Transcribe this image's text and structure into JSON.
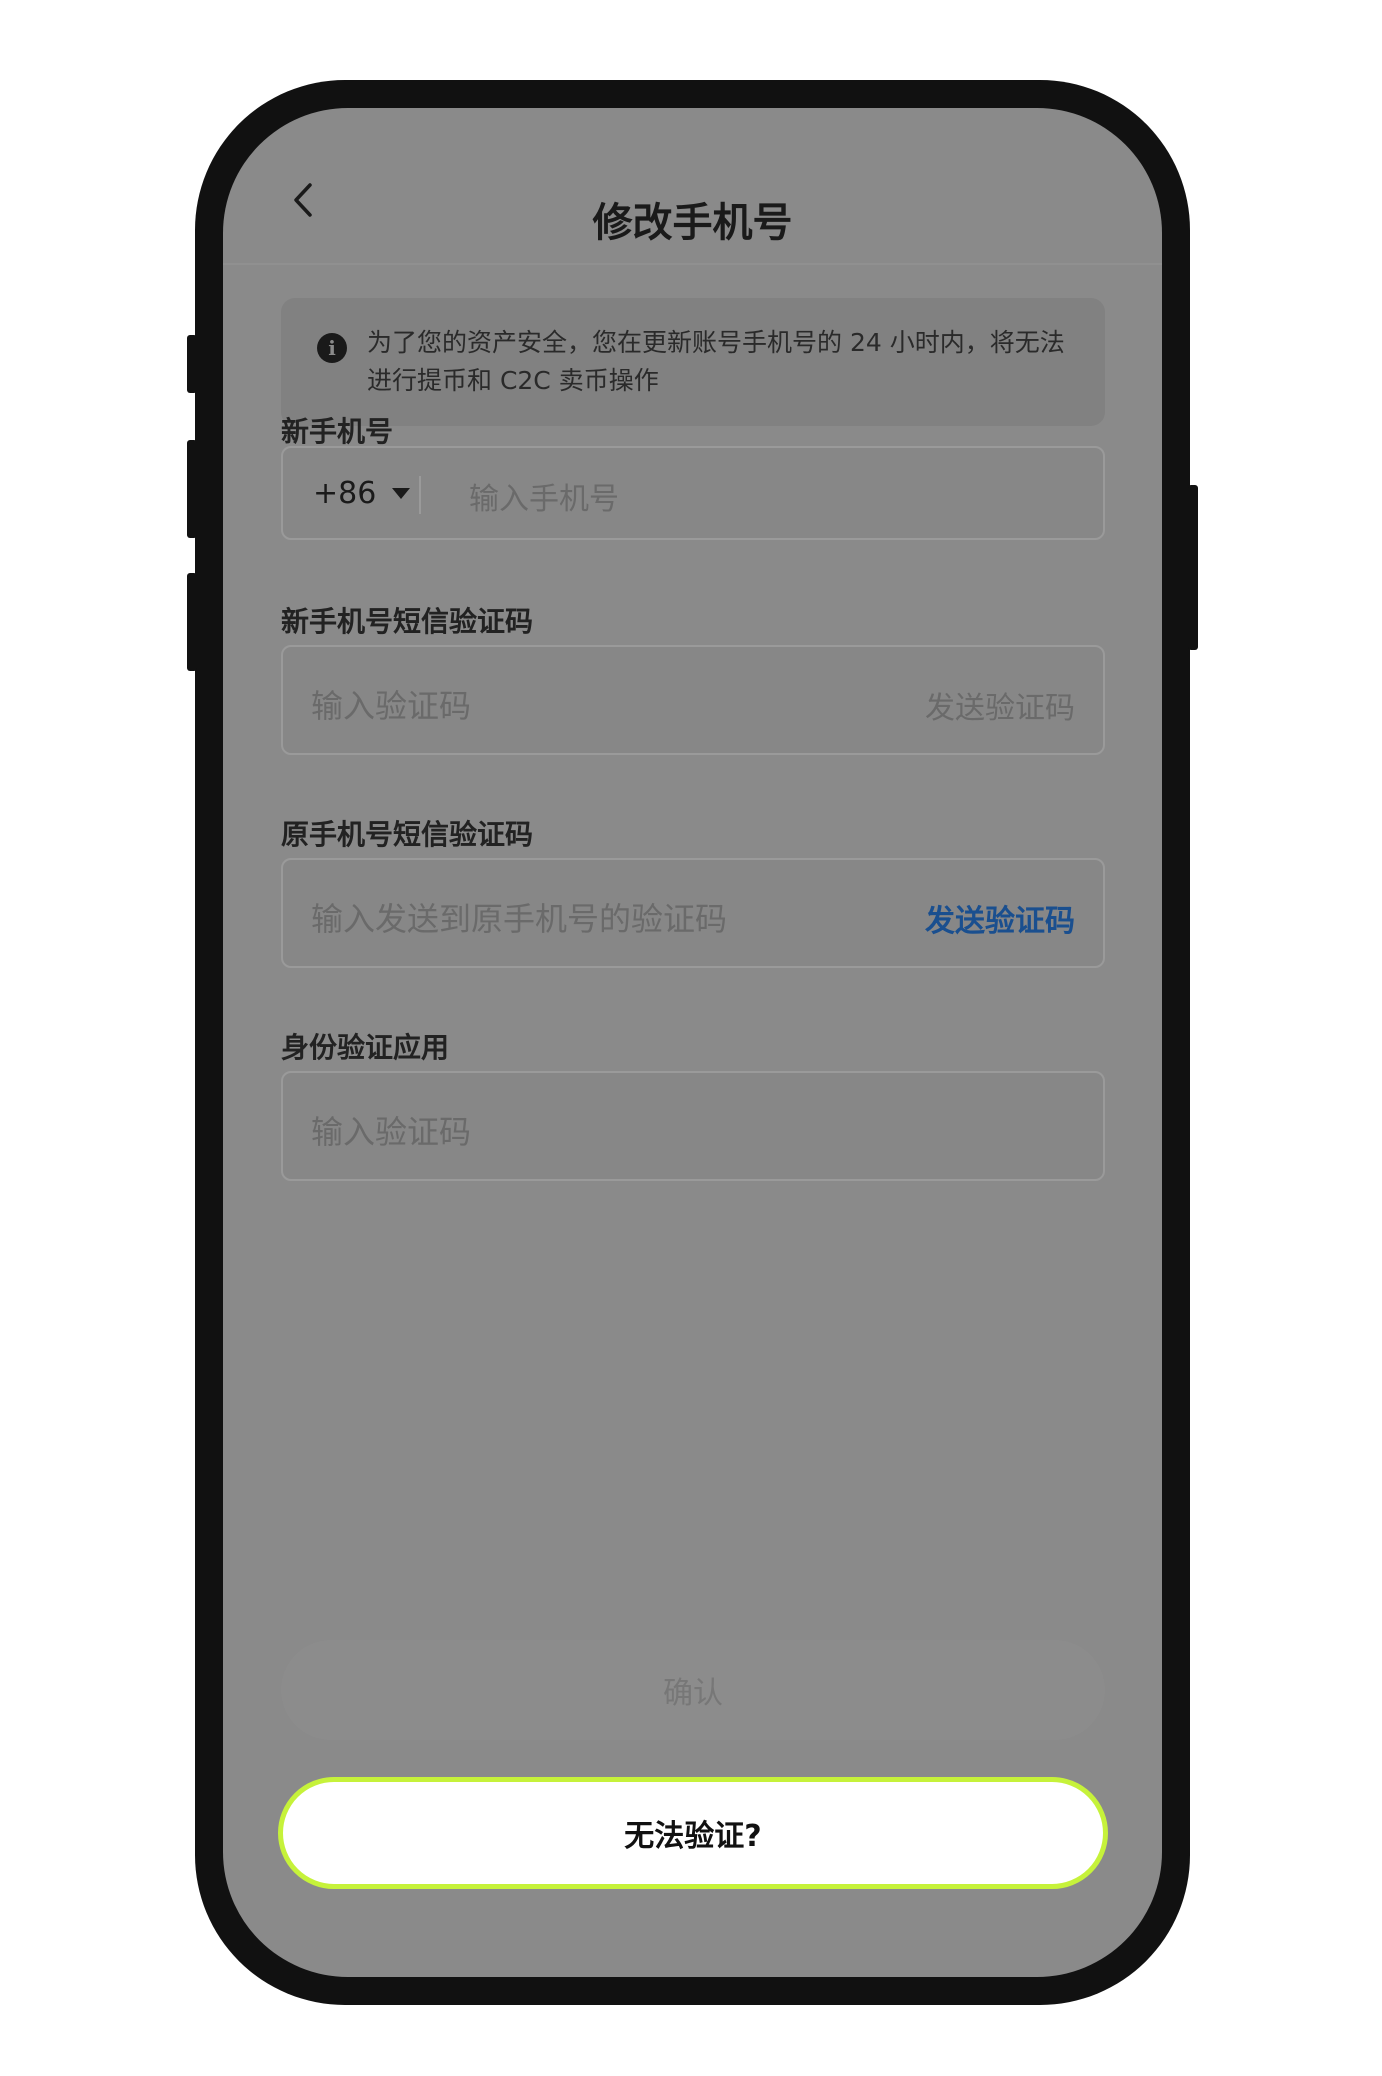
{
  "header": {
    "title": "修改手机号",
    "back_icon": "chevron-left-icon"
  },
  "notice": {
    "icon": "info-icon",
    "text": "为了您的资产安全，您在更新账号手机号的 24 小时内，将无法进行提币和 C2C 卖币操作"
  },
  "form": {
    "new_phone": {
      "label": "新手机号",
      "country_code": "+86",
      "placeholder": "输入手机号"
    },
    "new_sms": {
      "label": "新手机号短信验证码",
      "placeholder": "输入验证码",
      "send_label": "发送验证码"
    },
    "old_sms": {
      "label": "原手机号短信验证码",
      "placeholder": "输入发送到原手机号的验证码",
      "send_label": "发送验证码"
    },
    "authenticator": {
      "label": "身份验证应用",
      "placeholder": "输入验证码"
    }
  },
  "buttons": {
    "confirm": "确认",
    "cannot_verify": "无法验证?"
  },
  "colors": {
    "highlight_border": "#c6f23a",
    "link_blue": "#1a4f8f",
    "overlay_gray": "#8a8a8a"
  }
}
